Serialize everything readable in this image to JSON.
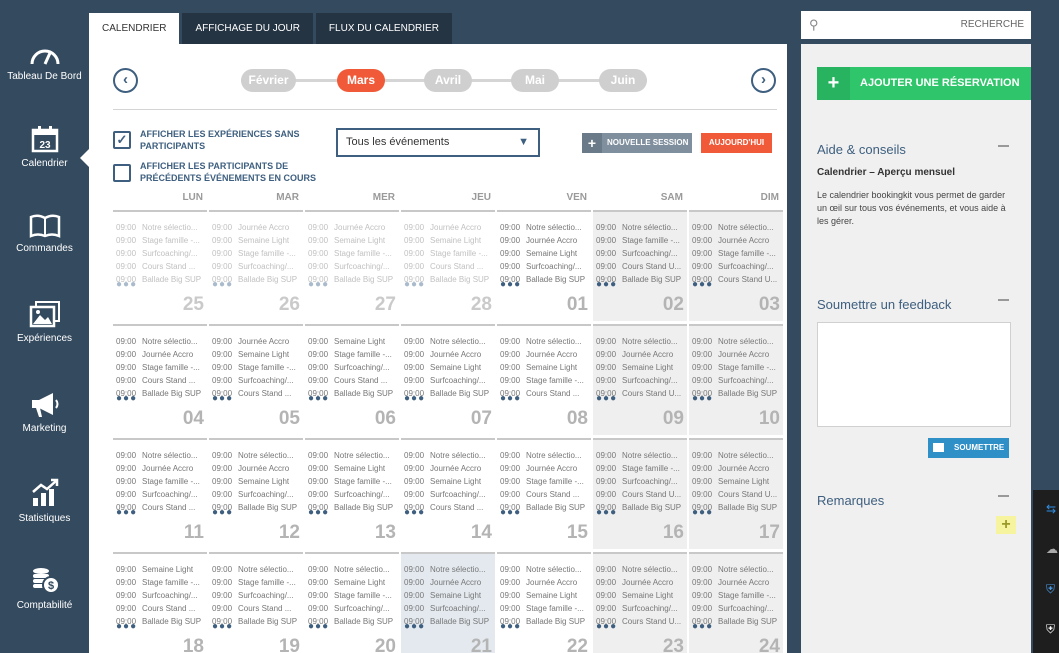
{
  "nav": {
    "items": [
      {
        "label": "Tableau De Bord",
        "icon": "dashboard-gauge-icon"
      },
      {
        "label": "Calendrier",
        "icon": "calendar-icon",
        "badge": "23"
      },
      {
        "label": "Commandes",
        "icon": "book-icon"
      },
      {
        "label": "Expériences",
        "icon": "photos-icon"
      },
      {
        "label": "Marketing",
        "icon": "megaphone-icon"
      },
      {
        "label": "Statistiques",
        "icon": "chart-icon"
      },
      {
        "label": "Comptabilité",
        "icon": "coins-icon"
      }
    ]
  },
  "tabs": [
    "Calendrier",
    "Affichage du jour",
    "Flux du calendrier"
  ],
  "months": {
    "prev_icon": "chevron-left-icon",
    "next_icon": "chevron-right-icon",
    "list": [
      "Février",
      "Mars",
      "Avril",
      "Mai",
      "Juin"
    ],
    "active": "Mars"
  },
  "filters": {
    "check1": {
      "label": "AFFICHER LES EXPÉRIENCES SANS PARTICIPANTS",
      "checked": true
    },
    "check2": {
      "label": "AFFICHER LES PARTICIPANTS DE PRÉCÉDENTS ÉVÉNEMENTS EN COURS",
      "checked": false
    },
    "select_value": "Tous les événements",
    "new_session_label": "NOUVELLE SESSION",
    "today_label": "AUJOURD'HUI"
  },
  "weekdays": [
    "LUN",
    "MAR",
    "MER",
    "JEU",
    "VEN",
    "SAM",
    "DIM"
  ],
  "weeks": [
    [
      {
        "day": "25",
        "dim": true,
        "events": [
          [
            "09:00",
            "Notre sélectio..."
          ],
          [
            "09:00",
            "Stage famille -..."
          ],
          [
            "09:00",
            "Surfcoaching/..."
          ],
          [
            "09:00",
            "Cours Stand ..."
          ],
          [
            "09:00",
            "Ballade Big SUP"
          ]
        ]
      },
      {
        "day": "26",
        "dim": true,
        "events": [
          [
            "09:00",
            "Journée Accro"
          ],
          [
            "09:00",
            "Semaine Light"
          ],
          [
            "09:00",
            "Stage famille -..."
          ],
          [
            "09:00",
            "Surfcoaching/..."
          ],
          [
            "09:00",
            "Ballade Big SUP"
          ]
        ]
      },
      {
        "day": "27",
        "dim": true,
        "events": [
          [
            "09:00",
            "Journée Accro"
          ],
          [
            "09:00",
            "Semaine Light"
          ],
          [
            "09:00",
            "Stage famille -..."
          ],
          [
            "09:00",
            "Surfcoaching/..."
          ],
          [
            "09:00",
            "Ballade Big SUP"
          ]
        ]
      },
      {
        "day": "28",
        "dim": true,
        "events": [
          [
            "09:00",
            "Journée Accro"
          ],
          [
            "09:00",
            "Semaine Light"
          ],
          [
            "09:00",
            "Stage famille -..."
          ],
          [
            "09:00",
            "Cours Stand ..."
          ],
          [
            "09:00",
            "Ballade Big SUP"
          ]
        ]
      },
      {
        "day": "01",
        "events": [
          [
            "09:00",
            "Notre sélectio..."
          ],
          [
            "09:00",
            "Journée Accro"
          ],
          [
            "09:00",
            "Semaine Light"
          ],
          [
            "09:00",
            "Surfcoaching/..."
          ],
          [
            "09:00",
            "Ballade Big SUP"
          ]
        ]
      },
      {
        "day": "02",
        "we": true,
        "events": [
          [
            "09:00",
            "Notre sélectio..."
          ],
          [
            "09:00",
            "Stage famille -..."
          ],
          [
            "09:00",
            "Surfcoaching/..."
          ],
          [
            "09:00",
            "Cours Stand U..."
          ],
          [
            "09:00",
            "Ballade Big SUP"
          ]
        ]
      },
      {
        "day": "03",
        "we": true,
        "events": [
          [
            "09:00",
            "Notre sélectio..."
          ],
          [
            "09:00",
            "Journée Accro"
          ],
          [
            "09:00",
            "Stage famille -..."
          ],
          [
            "09:00",
            "Surfcoaching/..."
          ],
          [
            "09:00",
            "Cours Stand U..."
          ]
        ]
      }
    ],
    [
      {
        "day": "04",
        "events": [
          [
            "09:00",
            "Notre sélectio..."
          ],
          [
            "09:00",
            "Journée Accro"
          ],
          [
            "09:00",
            "Stage famille -..."
          ],
          [
            "09:00",
            "Cours Stand ..."
          ],
          [
            "09:00",
            "Ballade Big SUP"
          ]
        ]
      },
      {
        "day": "05",
        "events": [
          [
            "09:00",
            "Journée Accro"
          ],
          [
            "09:00",
            "Semaine Light"
          ],
          [
            "09:00",
            "Stage famille -..."
          ],
          [
            "09:00",
            "Surfcoaching/..."
          ],
          [
            "09:00",
            "Cours Stand ..."
          ]
        ]
      },
      {
        "day": "06",
        "events": [
          [
            "09:00",
            "Semaine Light"
          ],
          [
            "09:00",
            "Stage famille -..."
          ],
          [
            "09:00",
            "Surfcoaching/..."
          ],
          [
            "09:00",
            "Cours Stand ..."
          ],
          [
            "09:00",
            "Ballade Big SUP"
          ]
        ]
      },
      {
        "day": "07",
        "events": [
          [
            "09:00",
            "Notre sélectio..."
          ],
          [
            "09:00",
            "Journée Accro"
          ],
          [
            "09:00",
            "Semaine Light"
          ],
          [
            "09:00",
            "Surfcoaching/..."
          ],
          [
            "09:00",
            "Ballade Big SUP"
          ]
        ]
      },
      {
        "day": "08",
        "events": [
          [
            "09:00",
            "Notre sélectio..."
          ],
          [
            "09:00",
            "Journée Accro"
          ],
          [
            "09:00",
            "Semaine Light"
          ],
          [
            "09:00",
            "Stage famille -..."
          ],
          [
            "09:00",
            "Cours Stand ..."
          ]
        ]
      },
      {
        "day": "09",
        "we": true,
        "events": [
          [
            "09:00",
            "Notre sélectio..."
          ],
          [
            "09:00",
            "Journée Accro"
          ],
          [
            "09:00",
            "Semaine Light"
          ],
          [
            "09:00",
            "Surfcoaching/..."
          ],
          [
            "09:00",
            "Cours Stand U..."
          ]
        ]
      },
      {
        "day": "10",
        "we": true,
        "events": [
          [
            "09:00",
            "Notre sélectio..."
          ],
          [
            "09:00",
            "Journée Accro"
          ],
          [
            "09:00",
            "Stage famille -..."
          ],
          [
            "09:00",
            "Surfcoaching/..."
          ],
          [
            "09:00",
            "Ballade Big SUP"
          ]
        ]
      }
    ],
    [
      {
        "day": "11",
        "events": [
          [
            "09:00",
            "Notre sélectio..."
          ],
          [
            "09:00",
            "Journée Accro"
          ],
          [
            "09:00",
            "Stage famille -..."
          ],
          [
            "09:00",
            "Surfcoaching/..."
          ],
          [
            "09:00",
            "Cours Stand ..."
          ]
        ]
      },
      {
        "day": "12",
        "events": [
          [
            "09:00",
            "Notre sélectio..."
          ],
          [
            "09:00",
            "Journée Accro"
          ],
          [
            "09:00",
            "Semaine Light"
          ],
          [
            "09:00",
            "Surfcoaching/..."
          ],
          [
            "09:00",
            "Ballade Big SUP"
          ]
        ]
      },
      {
        "day": "13",
        "events": [
          [
            "09:00",
            "Notre sélectio..."
          ],
          [
            "09:00",
            "Semaine Light"
          ],
          [
            "09:00",
            "Stage famille -..."
          ],
          [
            "09:00",
            "Surfcoaching/..."
          ],
          [
            "09:00",
            "Ballade Big SUP"
          ]
        ]
      },
      {
        "day": "14",
        "events": [
          [
            "09:00",
            "Notre sélectio..."
          ],
          [
            "09:00",
            "Journée Accro"
          ],
          [
            "09:00",
            "Semaine Light"
          ],
          [
            "09:00",
            "Surfcoaching/..."
          ],
          [
            "09:00",
            "Cours Stand ..."
          ]
        ]
      },
      {
        "day": "15",
        "events": [
          [
            "09:00",
            "Notre sélectio..."
          ],
          [
            "09:00",
            "Journée Accro"
          ],
          [
            "09:00",
            "Stage famille -..."
          ],
          [
            "09:00",
            "Cours Stand ..."
          ],
          [
            "09:00",
            "Ballade Big SUP"
          ]
        ]
      },
      {
        "day": "16",
        "we": true,
        "events": [
          [
            "09:00",
            "Notre sélectio..."
          ],
          [
            "09:00",
            "Stage famille -..."
          ],
          [
            "09:00",
            "Surfcoaching/..."
          ],
          [
            "09:00",
            "Cours Stand U..."
          ],
          [
            "09:00",
            "Ballade Big SUP"
          ]
        ]
      },
      {
        "day": "17",
        "we": true,
        "events": [
          [
            "09:00",
            "Notre sélectio..."
          ],
          [
            "09:00",
            "Journée Accro"
          ],
          [
            "09:00",
            "Semaine Light"
          ],
          [
            "09:00",
            "Cours Stand U..."
          ],
          [
            "09:00",
            "Ballade Big SUP"
          ]
        ]
      }
    ],
    [
      {
        "day": "18",
        "events": [
          [
            "09:00",
            "Semaine Light"
          ],
          [
            "09:00",
            "Stage famille -..."
          ],
          [
            "09:00",
            "Surfcoaching/..."
          ],
          [
            "09:00",
            "Cours Stand ..."
          ],
          [
            "09:00",
            "Ballade Big SUP"
          ]
        ]
      },
      {
        "day": "19",
        "events": [
          [
            "09:00",
            "Notre sélectio..."
          ],
          [
            "09:00",
            "Stage famille -..."
          ],
          [
            "09:00",
            "Surfcoaching/..."
          ],
          [
            "09:00",
            "Cours Stand ..."
          ],
          [
            "09:00",
            "Ballade Big SUP"
          ]
        ]
      },
      {
        "day": "20",
        "events": [
          [
            "09:00",
            "Notre sélectio..."
          ],
          [
            "09:00",
            "Semaine Light"
          ],
          [
            "09:00",
            "Stage famille -..."
          ],
          [
            "09:00",
            "Surfcoaching/..."
          ],
          [
            "09:00",
            "Ballade Big SUP"
          ]
        ]
      },
      {
        "day": "21",
        "sel": true,
        "events": [
          [
            "09:00",
            "Notre sélectio..."
          ],
          [
            "09:00",
            "Journée Accro"
          ],
          [
            "09:00",
            "Semaine Light"
          ],
          [
            "09:00",
            "Surfcoaching/..."
          ],
          [
            "09:00",
            "Ballade Big SUP"
          ]
        ]
      },
      {
        "day": "22",
        "events": [
          [
            "09:00",
            "Notre sélectio..."
          ],
          [
            "09:00",
            "Journée Accro"
          ],
          [
            "09:00",
            "Semaine Light"
          ],
          [
            "09:00",
            "Stage famille -..."
          ],
          [
            "09:00",
            "Ballade Big SUP"
          ]
        ]
      },
      {
        "day": "23",
        "we": true,
        "events": [
          [
            "09:00",
            "Notre sélectio..."
          ],
          [
            "09:00",
            "Journée Accro"
          ],
          [
            "09:00",
            "Semaine Light"
          ],
          [
            "09:00",
            "Surfcoaching/..."
          ],
          [
            "09:00",
            "Cours Stand U..."
          ]
        ]
      },
      {
        "day": "24",
        "we": true,
        "events": [
          [
            "09:00",
            "Notre sélectio..."
          ],
          [
            "09:00",
            "Journée Accro"
          ],
          [
            "09:00",
            "Stage famille -..."
          ],
          [
            "09:00",
            "Surfcoaching/..."
          ],
          [
            "09:00",
            "Ballade Big SUP"
          ]
        ]
      }
    ]
  ],
  "right": {
    "search_label": "RECHERCHE",
    "add_booking_label": "AJOUTER UNE RÉSERVATION",
    "aide_title": "Aide & conseils",
    "aide_subtitle": "Calendrier – Aperçu mensuel",
    "aide_text": "Le calendrier bookingkit vous permet de garder un œil sur tous vos événements, et vous aide à les gérer.",
    "feedback_title": "Soumettre un feedback",
    "submit_label": "SOUMETTRE",
    "remarks_title": "Remarques"
  },
  "colors": {
    "accent": "#f15a38",
    "navy": "#344a5e",
    "green": "#2fc56a",
    "blue": "#2f8fc7"
  }
}
